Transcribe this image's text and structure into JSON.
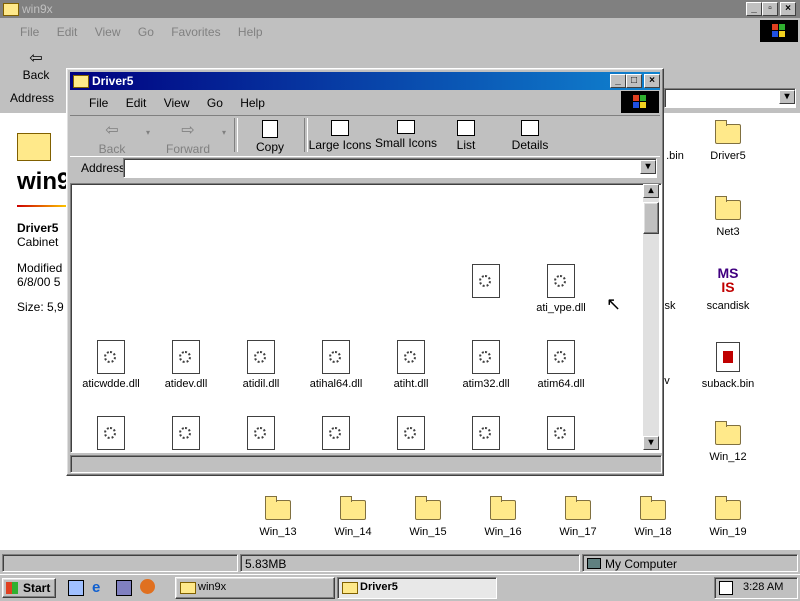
{
  "bg_window": {
    "title": "win9x",
    "menu": [
      "File",
      "Edit",
      "View",
      "Go",
      "Favorites",
      "Help"
    ],
    "toolbar": [
      "Back"
    ],
    "address_label": "Address",
    "left_panel": {
      "big_title": "win9",
      "file_name": "Driver5",
      "file_type": "Cabinet",
      "modified_label": "Modified",
      "modified_value": "6/8/00 5",
      "size_text": "Size: 5,9"
    },
    "right_icons": [
      {
        "label": ".bin",
        "kind": "file"
      },
      {
        "label": "Driver5",
        "kind": "folder"
      },
      {
        "label": "Net3",
        "kind": "folder"
      },
      {
        "label": "sk",
        "kind": "text"
      },
      {
        "label": "scandisk",
        "kind": "ms"
      },
      {
        "label": "v",
        "kind": "text"
      },
      {
        "label": "suback.bin",
        "kind": "file"
      },
      {
        "label": "Win_12",
        "kind": "folder"
      }
    ],
    "bottom_folders": [
      "Win_13",
      "Win_14",
      "Win_15",
      "Win_16",
      "Win_17",
      "Win_18",
      "Win_19"
    ],
    "status": {
      "size": "5.83MB",
      "location": "My Computer"
    }
  },
  "fg_window": {
    "title": "Driver5",
    "menu": [
      "File",
      "Edit",
      "View",
      "Go",
      "Help"
    ],
    "toolbar": {
      "back": "Back",
      "forward": "Forward",
      "copy": "Copy",
      "large_icons": "Large Icons",
      "small_icons": "Small Icons",
      "list": "List",
      "details": "Details"
    },
    "address_label": "Address",
    "address_value": "",
    "files_row1": [
      "",
      "ati_vpe.dll"
    ],
    "files_row2": [
      "aticwdde.dll",
      "atidev.dll",
      "atidil.dll",
      "atihal64.dll",
      "atiht.dll",
      "atim32.dll",
      "atim64.dll"
    ],
    "files_row3_count": 7
  },
  "taskbar": {
    "start": "Start",
    "tasks": [
      "win9x",
      "Driver5"
    ],
    "clock": "3:28 AM"
  }
}
